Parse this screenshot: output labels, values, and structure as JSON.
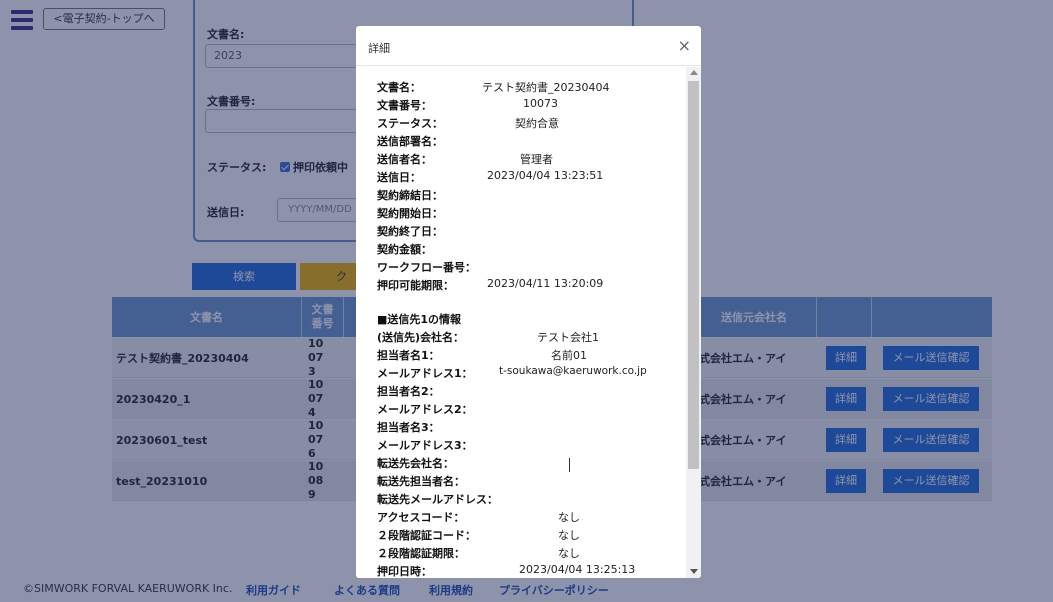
{
  "nav": {
    "back_label": "<電子契約-トップへ"
  },
  "search": {
    "doc_name_label": "文書名:",
    "doc_name_value": "2023",
    "doc_no_label": "文書番号:",
    "doc_no_value": "",
    "status_label": "ステータス:",
    "status_option": "押印依頼中",
    "send_date_label": "送信日:",
    "send_date_placeholder": "YYYY/MM/DD",
    "search_button": "検索",
    "clear_button": "クリ"
  },
  "table": {
    "headers": [
      "文書名",
      "文書番号",
      "送信元会社名"
    ],
    "rows": [
      {
        "name": "テスト契約書_20230404",
        "number": "10073",
        "company": "式会社エム・アイ",
        "detail": "詳細",
        "mail": "メール送信確認"
      },
      {
        "name": "20230420_1",
        "number": "10074",
        "company": "式会社エム・アイ",
        "detail": "詳細",
        "mail": "メール送信確認"
      },
      {
        "name": "20230601_test",
        "number": "10076",
        "company": "式会社エム・アイ",
        "detail": "詳細",
        "mail": "メール送信確認"
      },
      {
        "name": "test_20231010",
        "number": "10089",
        "company": "式会社エム・アイ",
        "detail": "詳細",
        "mail": "メール送信確認"
      }
    ]
  },
  "footer": {
    "copyright": "©SIMWORK FORVAL KAERUWORK Inc.",
    "links": [
      "利用ガイド",
      "よくある質問",
      "利用規約",
      "プライバシーポリシー"
    ]
  },
  "modal": {
    "title": "詳細",
    "close": "×",
    "fields": [
      {
        "label": "文書名：",
        "value": "テスト契約書_20230404"
      },
      {
        "label": "文書番号：",
        "value": "10073"
      },
      {
        "label": "ステータス：",
        "value": "契約合意"
      },
      {
        "label": "送信部署名：",
        "value": ""
      },
      {
        "label": "送信者名：",
        "value": "管理者"
      },
      {
        "label": "送信日：",
        "value": "2023/04/04 13:23:51"
      },
      {
        "label": "契約締結日：",
        "value": ""
      },
      {
        "label": "契約開始日：",
        "value": ""
      },
      {
        "label": "契約終了日：",
        "value": ""
      },
      {
        "label": "契約金額：",
        "value": ""
      },
      {
        "label": "ワークフロー番号：",
        "value": ""
      },
      {
        "label": "押印可能期限：",
        "value": "2023/04/11 13:20:09"
      }
    ],
    "recipient_title": "■送信先1の情報",
    "recipient_fields": [
      {
        "label": "(送信先)会社名：",
        "value": "テスト会社1"
      },
      {
        "label": "担当者名1：",
        "value": "名前01"
      },
      {
        "label": "メールアドレス1：",
        "value": "t-soukawa@kaeruwork.co.jp"
      },
      {
        "label": "担当者名2：",
        "value": ""
      },
      {
        "label": "メールアドレス2：",
        "value": ""
      },
      {
        "label": "担当者名3：",
        "value": ""
      },
      {
        "label": "メールアドレス3：",
        "value": ""
      },
      {
        "label": "転送先会社名：",
        "value": ""
      },
      {
        "label": "転送先担当者名：",
        "value": ""
      },
      {
        "label": "転送先メールアドレス：",
        "value": ""
      },
      {
        "label": "アクセスコード：",
        "value": "なし"
      },
      {
        "label": "２段階認証コード：",
        "value": "なし"
      },
      {
        "label": "２段階認証期限：",
        "value": "なし"
      },
      {
        "label": "押印日時：",
        "value": "2023/04/04 13:25:13"
      }
    ]
  }
}
